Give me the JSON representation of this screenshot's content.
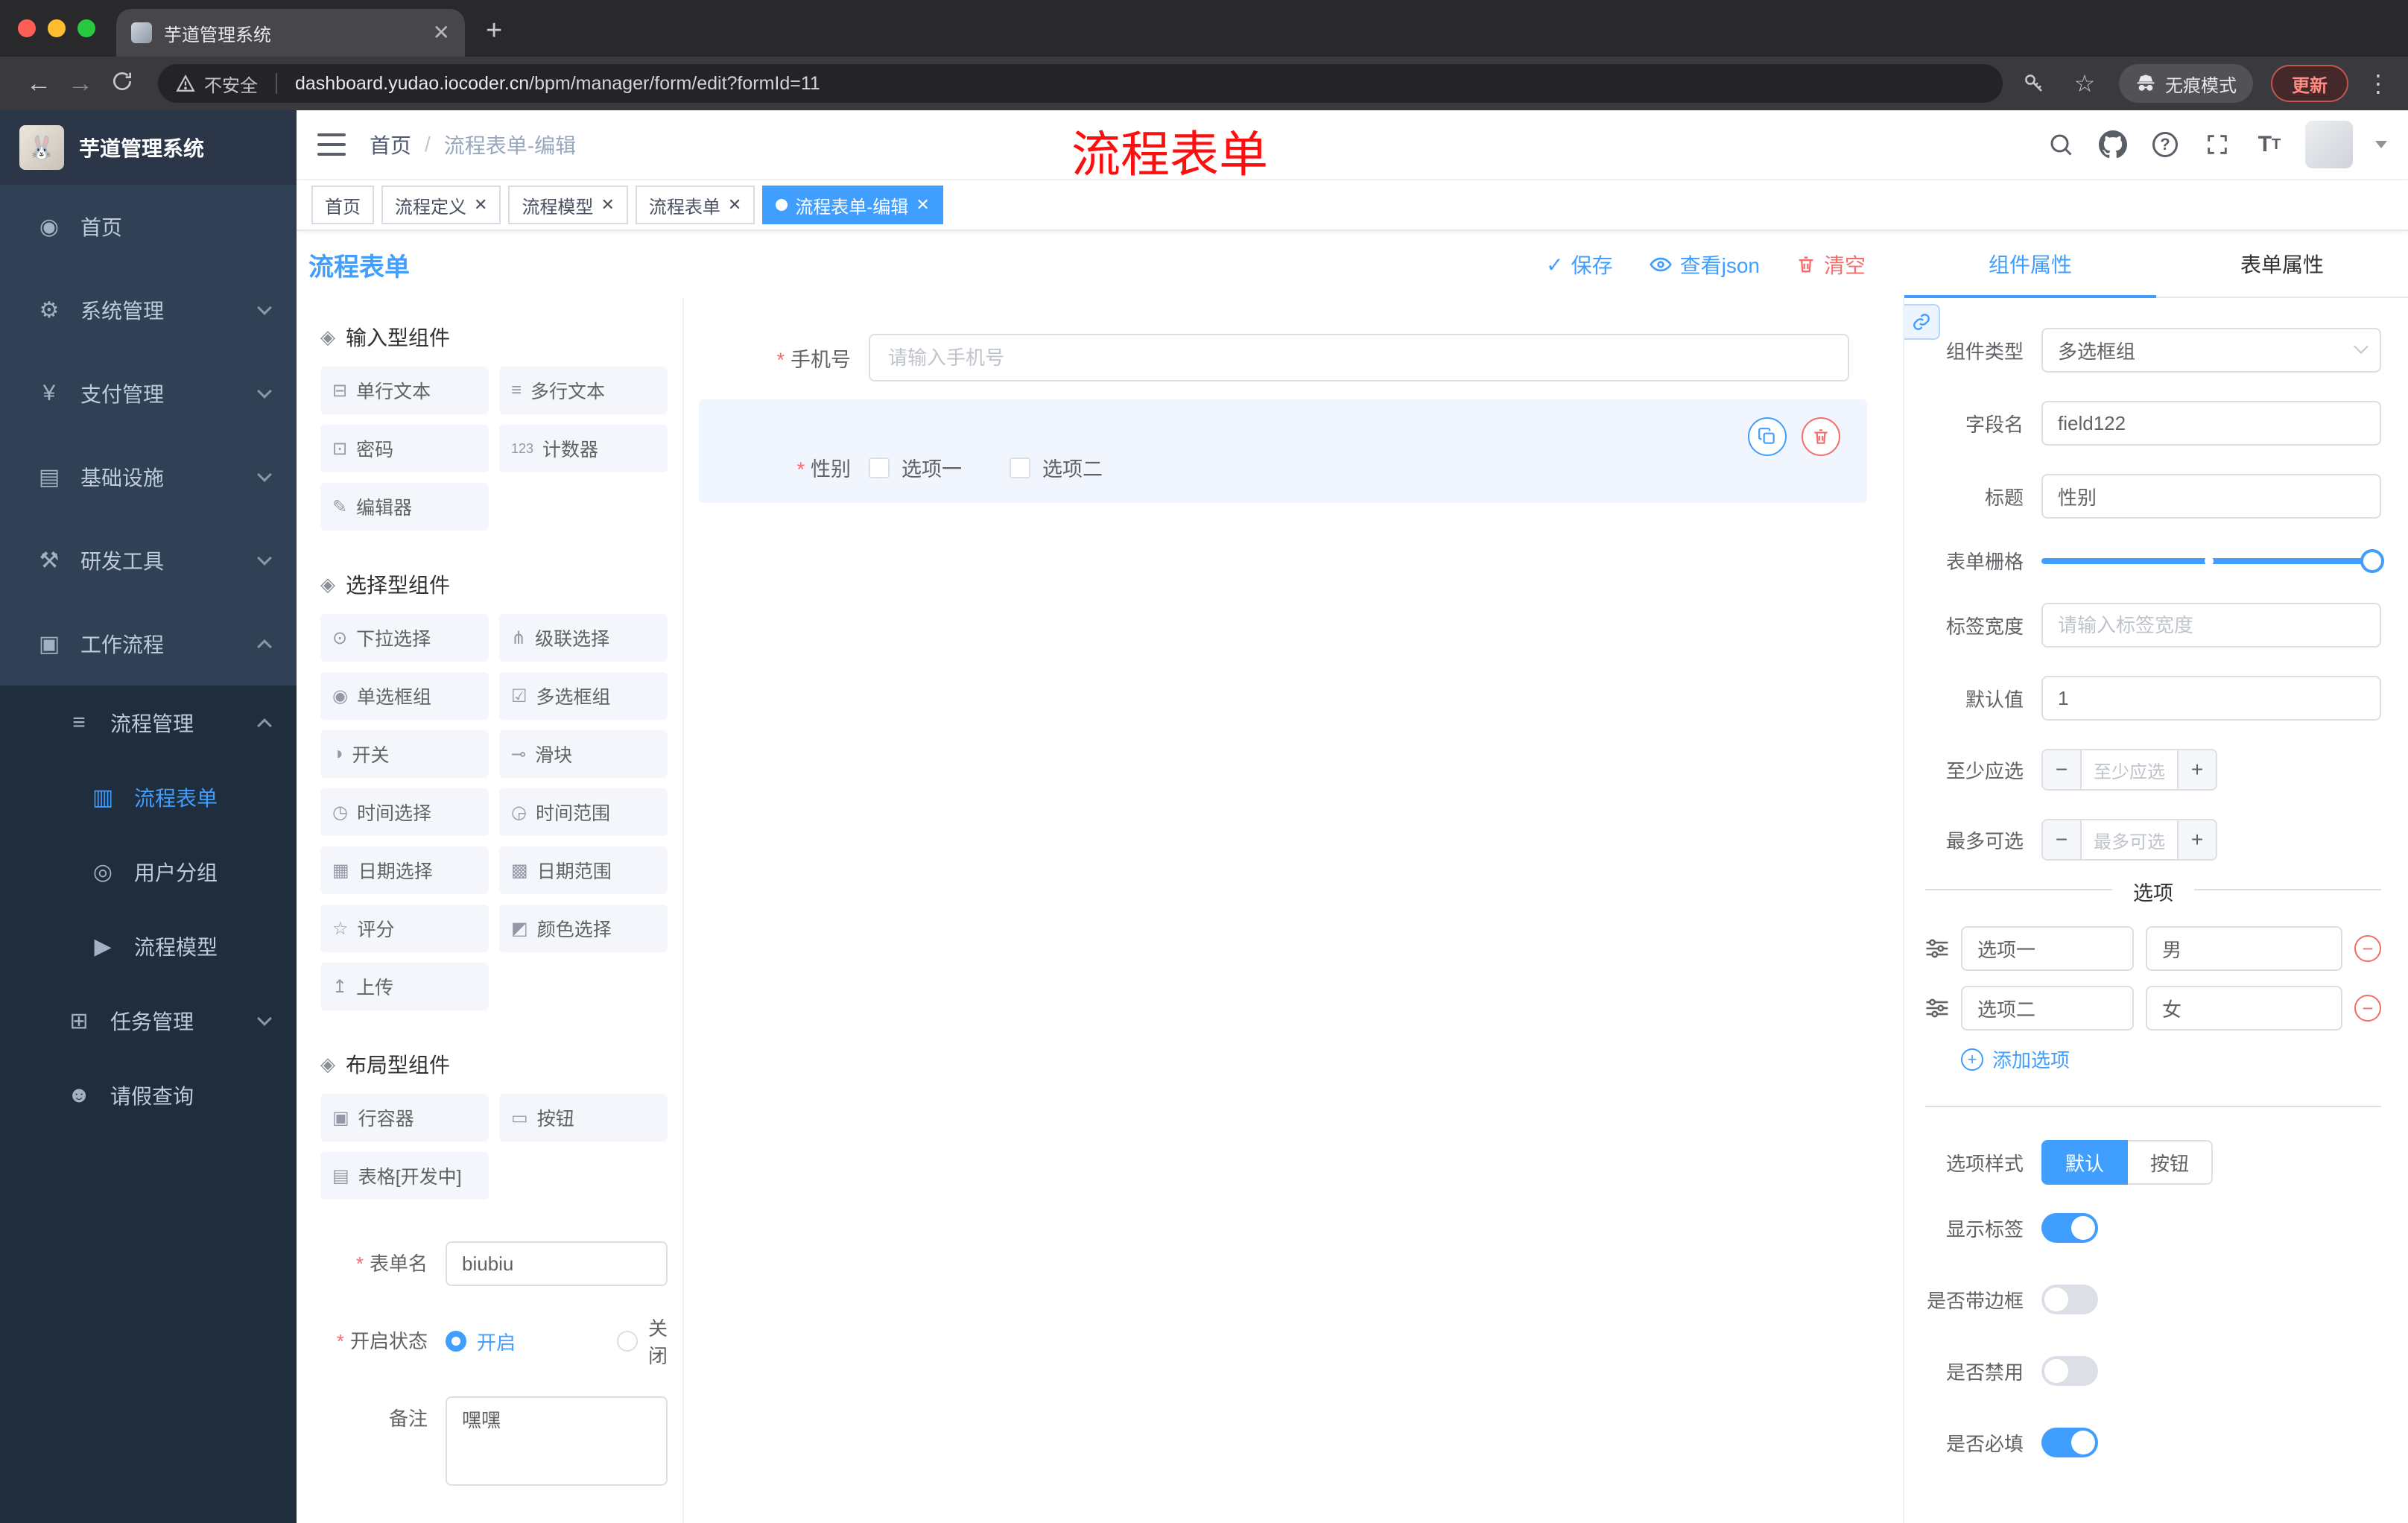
{
  "colors": {
    "accent": "#409eff",
    "danger": "#f56c6c",
    "annotation_red": "#fb0f0f",
    "sidebar_bg": "#304156",
    "active_tag_bg": "#409eff"
  },
  "browser": {
    "tab_title": "芋道管理系统",
    "new_tab": "+",
    "security_label": "不安全",
    "url_host": "dashboard.yudao.iocoder.cn",
    "url_path": "/bpm/manager/form/edit?formId=11",
    "incognito_label": "无痕模式",
    "update_label": "更新"
  },
  "sidebar": {
    "logo_title": "芋道管理系统",
    "menu": [
      {
        "label": "首页",
        "glyph": "◉"
      },
      {
        "label": "系统管理",
        "glyph": "⚙"
      },
      {
        "label": "支付管理",
        "glyph": "¥"
      },
      {
        "label": "基础设施",
        "glyph": "▤"
      },
      {
        "label": "研发工具",
        "glyph": "⚒"
      },
      {
        "label": "工作流程",
        "glyph": "▣"
      },
      {
        "label": "流程管理",
        "glyph": "≡"
      },
      {
        "label": "流程表单",
        "glyph": "▥"
      },
      {
        "label": "用户分组",
        "glyph": "◎"
      },
      {
        "label": "流程模型",
        "glyph": "▶"
      },
      {
        "label": "任务管理",
        "glyph": "⊞"
      },
      {
        "label": "请假查询",
        "glyph": "☻"
      }
    ]
  },
  "header": {
    "breadcrumb_home": "首页",
    "breadcrumb_sep": "/",
    "breadcrumb_current": "流程表单-编辑",
    "annotation": "流程表单"
  },
  "tags": [
    {
      "label": "首页"
    },
    {
      "label": "流程定义"
    },
    {
      "label": "流程模型"
    },
    {
      "label": "流程表单"
    },
    {
      "label": "流程表单-编辑"
    }
  ],
  "designer": {
    "title": "流程表单",
    "save_label": "保存",
    "view_json_label": "查看json",
    "clear_label": "清空"
  },
  "palette": {
    "groups": [
      {
        "title": "输入型组件",
        "items": [
          {
            "label": "单行文本",
            "glyph": "⊟"
          },
          {
            "label": "多行文本",
            "glyph": "≡"
          },
          {
            "label": "密码",
            "glyph": "⊡"
          },
          {
            "label": "计数器",
            "glyph": "123"
          },
          {
            "label": "编辑器",
            "glyph": "✎"
          }
        ]
      },
      {
        "title": "选择型组件",
        "items": [
          {
            "label": "下拉选择",
            "glyph": "⊙"
          },
          {
            "label": "级联选择",
            "glyph": "⋔"
          },
          {
            "label": "单选框组",
            "glyph": "◉"
          },
          {
            "label": "多选框组",
            "glyph": "☑"
          },
          {
            "label": "开关",
            "glyph": "◑"
          },
          {
            "label": "滑块",
            "glyph": "⊸"
          },
          {
            "label": "时间选择",
            "glyph": "◷"
          },
          {
            "label": "时间范围",
            "glyph": "◶"
          },
          {
            "label": "日期选择",
            "glyph": "▦"
          },
          {
            "label": "日期范围",
            "glyph": "▩"
          },
          {
            "label": "评分",
            "glyph": "☆"
          },
          {
            "label": "颜色选择",
            "glyph": "◩"
          },
          {
            "label": "上传",
            "glyph": "↥"
          }
        ]
      },
      {
        "title": "布局型组件",
        "items": [
          {
            "label": "行容器",
            "glyph": "▣"
          },
          {
            "label": "按钮",
            "glyph": "▭"
          },
          {
            "label": "表格[开发中]",
            "glyph": "▤"
          }
        ]
      }
    ],
    "form": {
      "name_label": "表单名",
      "name_value": "biubiu",
      "status_label": "开启状态",
      "status_on": "开启",
      "status_off": "关闭",
      "remark_label": "备注",
      "remark_value": "嘿嘿"
    }
  },
  "canvas": {
    "phone_label": "手机号",
    "phone_placeholder": "请输入手机号",
    "gender_label": "性别",
    "gender_options": [
      "选项一",
      "选项二"
    ]
  },
  "props": {
    "tab_component": "组件属性",
    "tab_form": "表单属性",
    "type_label": "组件类型",
    "type_value": "多选框组",
    "field_label": "字段名",
    "field_value": "field122",
    "title_label": "标题",
    "title_value": "性别",
    "grid_label": "表单栅格",
    "width_label": "标签宽度",
    "width_placeholder": "请输入标签宽度",
    "default_label": "默认值",
    "default_value": "1",
    "min_label": "至少应选",
    "min_placeholder": "至少应选",
    "max_label": "最多可选",
    "max_placeholder": "最多可选",
    "options_title": "选项",
    "options": [
      {
        "label": "选项一",
        "value": "男"
      },
      {
        "label": "选项二",
        "value": "女"
      }
    ],
    "add_option": "添加选项",
    "style_label": "选项样式",
    "style_options": [
      "默认",
      "按钮"
    ],
    "switches": [
      {
        "label": "显示标签",
        "on": true
      },
      {
        "label": "是否带边框",
        "on": false
      },
      {
        "label": "是否禁用",
        "on": false
      },
      {
        "label": "是否必填",
        "on": true
      }
    ]
  }
}
